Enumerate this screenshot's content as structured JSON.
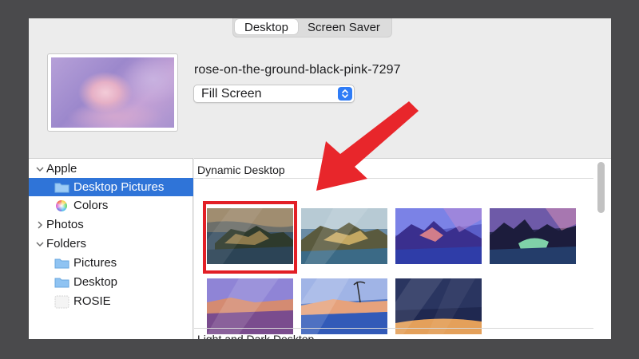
{
  "tabs": [
    {
      "label": "Desktop",
      "active": true
    },
    {
      "label": "Screen Saver",
      "active": false
    }
  ],
  "current_wallpaper": {
    "file_name": "rose-on-the-ground-black-pink-7297",
    "fill_mode": "Fill Screen"
  },
  "sidebar": {
    "items": [
      {
        "label": "Apple",
        "level": 0,
        "expanded": true
      },
      {
        "label": "Desktop Pictures",
        "level": 1,
        "selected": true,
        "icon": "folder-icon"
      },
      {
        "label": "Colors",
        "level": 1,
        "icon": "color-wheel-icon"
      },
      {
        "label": "Photos",
        "level": 0,
        "expanded": false
      },
      {
        "label": "Folders",
        "level": 0,
        "expanded": true
      },
      {
        "label": "Pictures",
        "level": 1,
        "icon": "folder-icon"
      },
      {
        "label": "Desktop",
        "level": 1,
        "icon": "folder-icon"
      },
      {
        "label": "ROSIE",
        "level": 1,
        "icon": "blank-folder-icon"
      }
    ]
  },
  "content": {
    "section_dynamic": "Dynamic Desktop",
    "section_light_dark": "Light and Dark Desktop",
    "selected_thumbnail": 1
  },
  "colors": {
    "selection_blue": "#2f74d8",
    "highlight_red": "#e21f26",
    "stepper_blue": "#2f7cf6"
  }
}
